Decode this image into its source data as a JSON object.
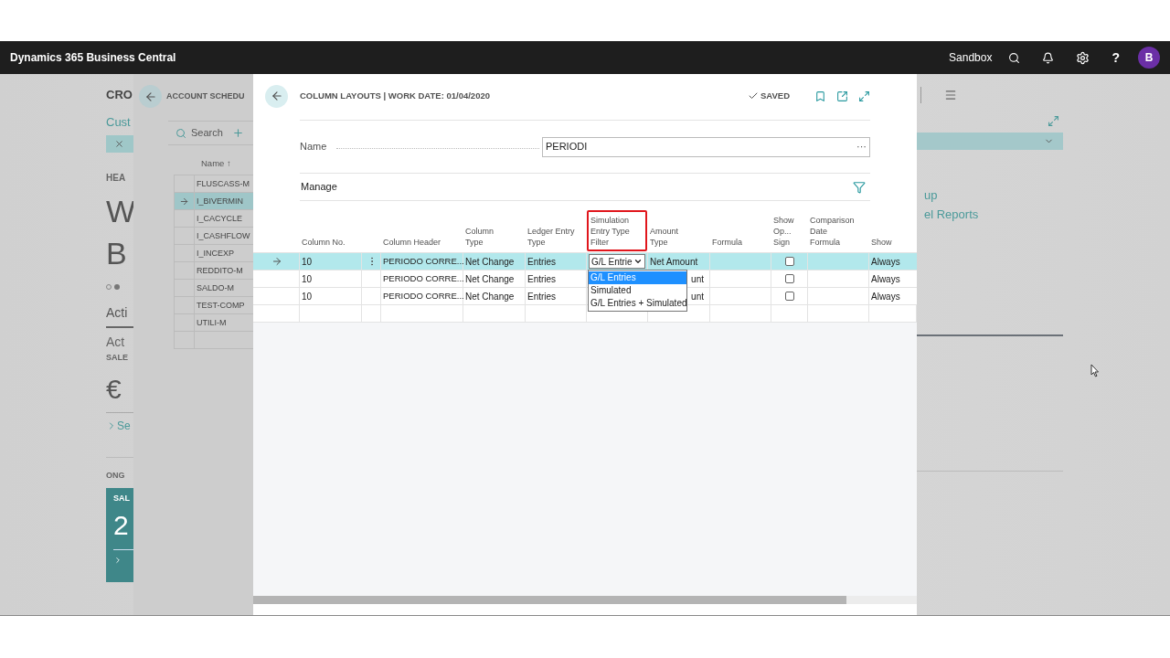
{
  "top_bar": {
    "app_name": "Dynamics 365 Business Central",
    "environment": "Sandbox",
    "help": "?",
    "avatar": "B"
  },
  "background_page": {
    "title": "CRO",
    "link": "Cust",
    "section": "HEA",
    "big_1": "W",
    "big_2": "B",
    "dots": [
      {
        "selected": false
      },
      {
        "selected": true
      }
    ],
    "tab": "Acti",
    "heading": "Act",
    "label": "SALE",
    "amount": "€",
    "link_2": "Se",
    "section_2": "ONG",
    "tile": {
      "label": "SAL",
      "value": "2"
    },
    "right_links": [
      "up",
      "el Reports"
    ]
  },
  "account_schedules": {
    "title": "ACCOUNT SCHEDU",
    "search": "Search",
    "column": "Name ↑",
    "rows": [
      {
        "name": "FLUSCASS-M",
        "selected": false
      },
      {
        "name": "I_BIVERMIN",
        "selected": true
      },
      {
        "name": "I_CACYCLE",
        "selected": false
      },
      {
        "name": "I_CASHFLOW",
        "selected": false
      },
      {
        "name": "I_INCEXP",
        "selected": false
      },
      {
        "name": "REDDITO-M",
        "selected": false
      },
      {
        "name": "SALDO-M",
        "selected": false
      },
      {
        "name": "TEST-COMP",
        "selected": false
      },
      {
        "name": "UTILI-M",
        "selected": false
      }
    ]
  },
  "dialog": {
    "title": "COLUMN LAYOUTS | WORK DATE: 01/04/2020",
    "status": "SAVED",
    "name_label": "Name",
    "name_value": "PERIODI",
    "name_more": "···",
    "manage": "Manage",
    "columns": [
      {
        "lines": [
          "Column No."
        ],
        "highlighted": false
      },
      {
        "lines": [
          "Column Header"
        ],
        "highlighted": false
      },
      {
        "lines": [
          "Column",
          "Type"
        ],
        "highlighted": false
      },
      {
        "lines": [
          "Ledger Entry",
          "Type"
        ],
        "highlighted": false
      },
      {
        "lines": [
          "Simulation",
          "Entry Type",
          "Filter"
        ],
        "highlighted": true
      },
      {
        "lines": [
          "Amount",
          "Type"
        ],
        "highlighted": false
      },
      {
        "lines": [
          "Formula"
        ],
        "highlighted": false
      },
      {
        "lines": [
          "Show",
          "Op...",
          "Sign"
        ],
        "highlighted": false
      },
      {
        "lines": [
          "Comparison",
          "Date",
          "Formula"
        ],
        "highlighted": false
      },
      {
        "lines": [
          "Show"
        ],
        "highlighted": false
      }
    ],
    "rows": [
      {
        "selected": true,
        "column_no": "10",
        "column_header": "PERIODO CORRE...",
        "column_type": "Net Change",
        "ledger_entry_type": "Entries",
        "simulation_filter": "G/L Entrie",
        "amount_type": "Net Amount",
        "amount_type_cut": false,
        "show_opposite_sign": false,
        "show": "Always"
      },
      {
        "selected": false,
        "column_no": "10",
        "column_header": "PERIODO CORRE...",
        "column_type": "Net Change",
        "ledger_entry_type": "Entries",
        "amount_type": "unt",
        "amount_type_cut": true,
        "show_opposite_sign": false,
        "show": "Always"
      },
      {
        "selected": false,
        "column_no": "10",
        "column_header": "PERIODO CORRE...",
        "column_type": "Net Change",
        "ledger_entry_type": "Entries",
        "amount_type": "unt",
        "amount_type_cut": true,
        "show_opposite_sign": false,
        "show": "Always"
      }
    ],
    "dropdown_options": [
      {
        "label": "G/L Entries",
        "selected": true
      },
      {
        "label": "Simulated",
        "selected": false
      },
      {
        "label": "G/L Entries + Simulated",
        "selected": false
      }
    ]
  }
}
